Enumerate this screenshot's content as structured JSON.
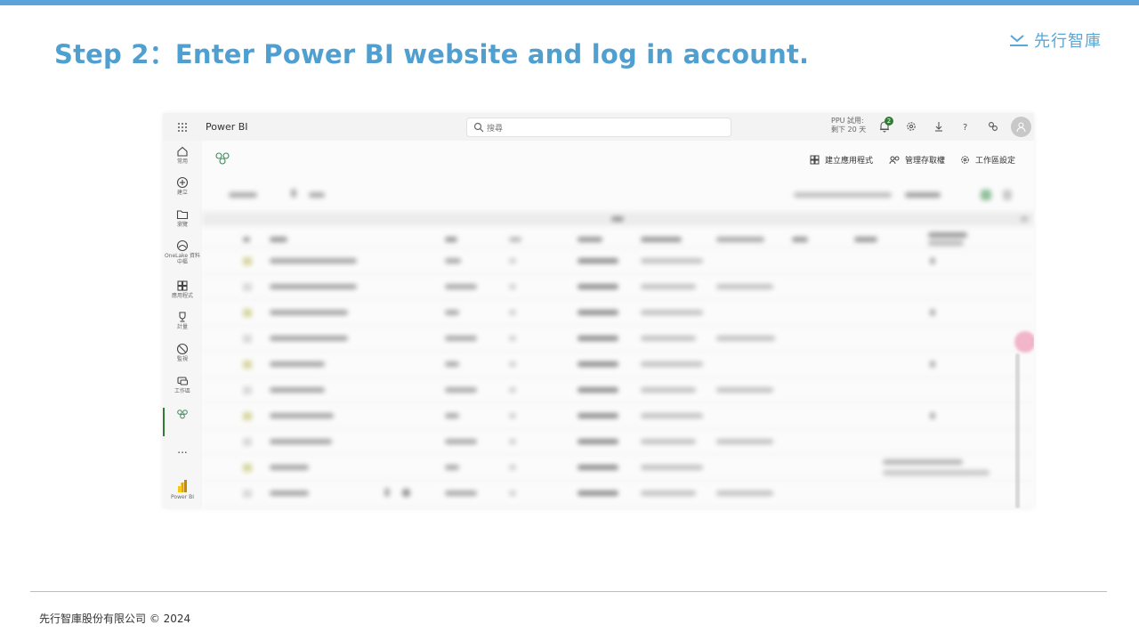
{
  "slide": {
    "title": "Step 2：Enter Power BI website and log in account.",
    "brand": "先行智庫",
    "footer": "先行智庫股份有限公司 © 2024",
    "accent_color": "#5ba3d8"
  },
  "screenshot": {
    "header": {
      "app_name": "Power BI",
      "search_placeholder": "搜尋",
      "trial_line1": "PPU 試用:",
      "trial_line2": "剩下 20 天",
      "notification_count": "2",
      "icons": [
        "waffle-icon",
        "search-icon",
        "bell-icon",
        "gear-icon",
        "download-icon",
        "help-icon",
        "share-icon",
        "avatar"
      ]
    },
    "nav": [
      {
        "label": "常用",
        "icon": "home-icon"
      },
      {
        "label": "建立",
        "icon": "plus-circle-icon"
      },
      {
        "label": "瀏覽",
        "icon": "folder-icon"
      },
      {
        "label": "OneLake 資料中樞",
        "icon": "onelake-icon"
      },
      {
        "label": "應用程式",
        "icon": "apps-icon"
      },
      {
        "label": "計量",
        "icon": "trophy-icon"
      },
      {
        "label": "監視",
        "icon": "monitor-icon"
      },
      {
        "label": "工作區",
        "icon": "workspace-icon"
      },
      {
        "label": "",
        "icon": "workspace-group-icon"
      },
      {
        "label": "...",
        "icon": "more-icon"
      },
      {
        "label": "Power BI",
        "icon": "powerbi-logo-icon"
      }
    ],
    "workspace_actions": [
      {
        "label": "建立應用程式",
        "icon": "create-app-icon"
      },
      {
        "label": "管理存取權",
        "icon": "manage-access-icon"
      },
      {
        "label": "工作區設定",
        "icon": "settings-icon"
      }
    ]
  }
}
